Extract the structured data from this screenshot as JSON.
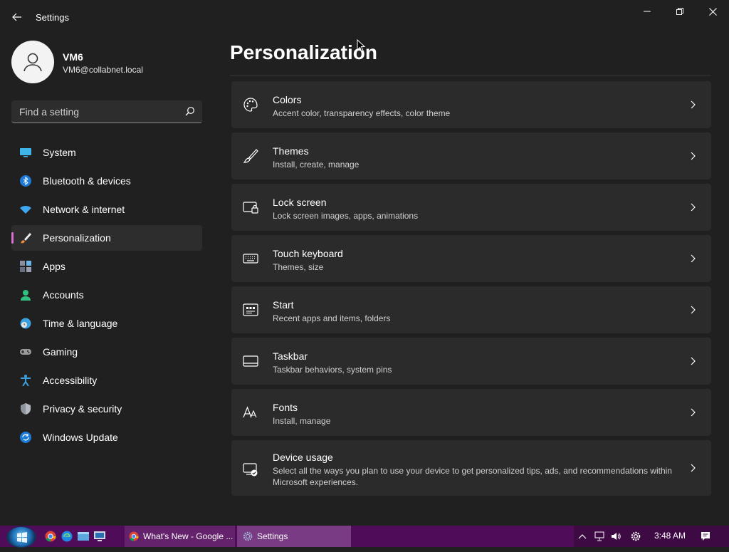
{
  "window": {
    "title": "Settings"
  },
  "profile": {
    "name": "VM6",
    "email": "VM6@collabnet.local"
  },
  "search": {
    "placeholder": "Find a setting"
  },
  "nav": {
    "items": [
      {
        "label": "System",
        "icon": "monitor-icon"
      },
      {
        "label": "Bluetooth & devices",
        "icon": "bluetooth-icon"
      },
      {
        "label": "Network & internet",
        "icon": "wifi-icon"
      },
      {
        "label": "Personalization",
        "icon": "paintbrush-icon",
        "active": true
      },
      {
        "label": "Apps",
        "icon": "apps-icon"
      },
      {
        "label": "Accounts",
        "icon": "person-icon"
      },
      {
        "label": "Time & language",
        "icon": "globe-clock-icon"
      },
      {
        "label": "Gaming",
        "icon": "gamepad-icon"
      },
      {
        "label": "Accessibility",
        "icon": "accessibility-icon"
      },
      {
        "label": "Privacy & security",
        "icon": "shield-icon"
      },
      {
        "label": "Windows Update",
        "icon": "update-icon"
      }
    ]
  },
  "page": {
    "title": "Personalization"
  },
  "cards": [
    {
      "title": "Colors",
      "desc": "Accent color, transparency effects, color theme",
      "icon": "palette-icon"
    },
    {
      "title": "Themes",
      "desc": "Install, create, manage",
      "icon": "brush-icon"
    },
    {
      "title": "Lock screen",
      "desc": "Lock screen images, apps, animations",
      "icon": "lock-screen-icon"
    },
    {
      "title": "Touch keyboard",
      "desc": "Themes, size",
      "icon": "keyboard-icon"
    },
    {
      "title": "Start",
      "desc": "Recent apps and items, folders",
      "icon": "start-icon"
    },
    {
      "title": "Taskbar",
      "desc": "Taskbar behaviors, system pins",
      "icon": "taskbar-icon"
    },
    {
      "title": "Fonts",
      "desc": "Install, manage",
      "icon": "fonts-icon"
    },
    {
      "title": "Device usage",
      "desc": "Select all the ways you plan to use your device to get personalized tips, ads, and recommendations within Microsoft experiences.",
      "icon": "device-usage-icon"
    }
  ],
  "taskbar": {
    "tasks": [
      {
        "label": "What's New - Google ...",
        "icon": "chrome-icon"
      },
      {
        "label": "Settings",
        "icon": "settings-gear-icon"
      }
    ],
    "clock": "3:48 AM"
  },
  "colors": {
    "background": "#202020",
    "card": "#2b2b2b",
    "accent": "#d86fd0",
    "taskbar": "#4f0c58"
  }
}
